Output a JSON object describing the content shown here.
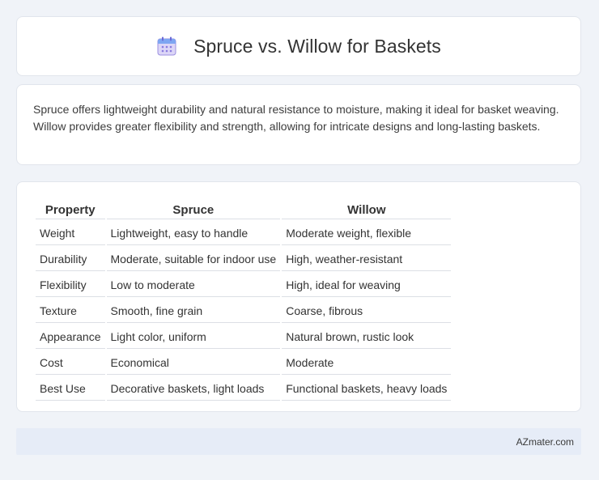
{
  "header": {
    "icon": "calendar-icon",
    "title": "Spruce vs. Willow for Baskets"
  },
  "summary": {
    "text": "Spruce offers lightweight durability and natural resistance to moisture, making it ideal for basket weaving. Willow provides greater flexibility and strength, allowing for intricate designs and long-lasting baskets."
  },
  "comparison_table": {
    "headers": [
      "Property",
      "Spruce",
      "Willow"
    ],
    "rows": [
      [
        "Weight",
        "Lightweight, easy to handle",
        "Moderate weight, flexible"
      ],
      [
        "Durability",
        "Moderate, suitable for indoor use",
        "High, weather-resistant"
      ],
      [
        "Flexibility",
        "Low to moderate",
        "High, ideal for weaving"
      ],
      [
        "Texture",
        "Smooth, fine grain",
        "Coarse, fibrous"
      ],
      [
        "Appearance",
        "Light color, uniform",
        "Natural brown, rustic look"
      ],
      [
        "Cost",
        "Economical",
        "Moderate"
      ],
      [
        "Best Use",
        "Decorative baskets, light loads",
        "Functional baskets, heavy loads"
      ]
    ]
  },
  "footer": {
    "brand": "AZmater.com"
  }
}
